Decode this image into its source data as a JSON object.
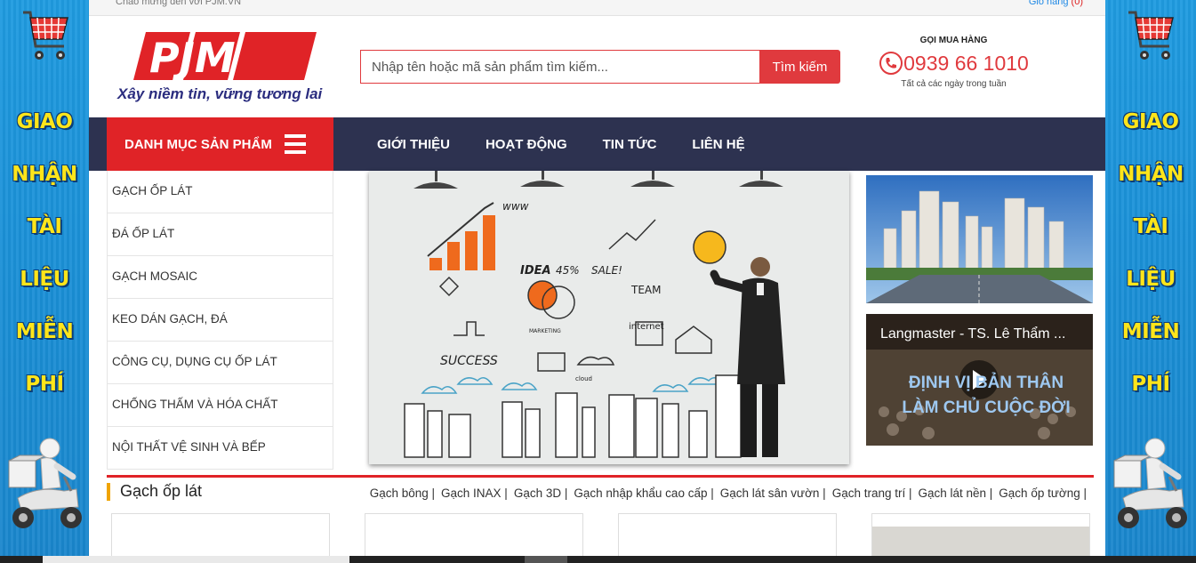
{
  "topbar": {
    "welcome": "Chào mừng đến với PJM.VN",
    "cart_label": "Giỏ hàng",
    "cart_count": "(0)"
  },
  "header": {
    "logo_text": "PJM",
    "slogan": "Xây niềm tin, vững tương lai",
    "search": {
      "placeholder": "Nhập tên hoặc mã sản phẩm tìm kiếm...",
      "button": "Tìm kiếm"
    },
    "hotline": {
      "label": "GỌI MUA HÀNG",
      "phone": "0939 66 1010",
      "note": "Tất cả các ngày trong tuần"
    }
  },
  "nav": {
    "category_toggle": "DANH MỤC SẢN PHẨM",
    "links": [
      "GIỚI THIỆU",
      "HOẠT ĐỘNG",
      "TIN TỨC",
      "LIÊN HỆ"
    ]
  },
  "categories": [
    "GẠCH ỐP LÁT",
    "ĐÁ ỐP LÁT",
    "GẠCH MOSAIC",
    "KEO DÁN GẠCH, ĐÁ",
    "CÔNG CỤ, DỤNG CỤ ỐP LÁT",
    "CHỐNG THẤM VÀ HÓA CHẤT",
    "NỘI THẤT VỆ SINH VÀ BẾP"
  ],
  "slider": {
    "doodle_words": [
      "www",
      "IDEA",
      "45%",
      "SALE!",
      "TEAM",
      "SUCCESS",
      "internet",
      "cloud",
      "MARKETING"
    ]
  },
  "side_banner": {
    "words": [
      "GIAO",
      "NHẬN",
      "TÀI",
      "LIỆU",
      "MIỄN",
      "PHÍ"
    ]
  },
  "video": {
    "title": "Langmaster - TS. Lê Thẩm ...",
    "overlay_line1": "ĐỊNH VỊ BẢN THÂN",
    "overlay_line2": "LÀM CHỦ CUỘC ĐỜI"
  },
  "section": {
    "title": "Gạch ốp lát",
    "sub_links": [
      "Gạch bông |",
      "Gạch INAX |",
      "Gạch 3D |",
      "Gạch nhập khẩu cao cấp |",
      "Gạch lát sân vườn |",
      "Gạch trang trí |",
      "Gạch lát nền |",
      "Gạch ốp tường |"
    ]
  },
  "colors": {
    "brand_red": "#e02327",
    "nav_bg": "#2d3250",
    "banner_blue": "#1f9be0",
    "promo_yellow": "#ffe51a"
  }
}
